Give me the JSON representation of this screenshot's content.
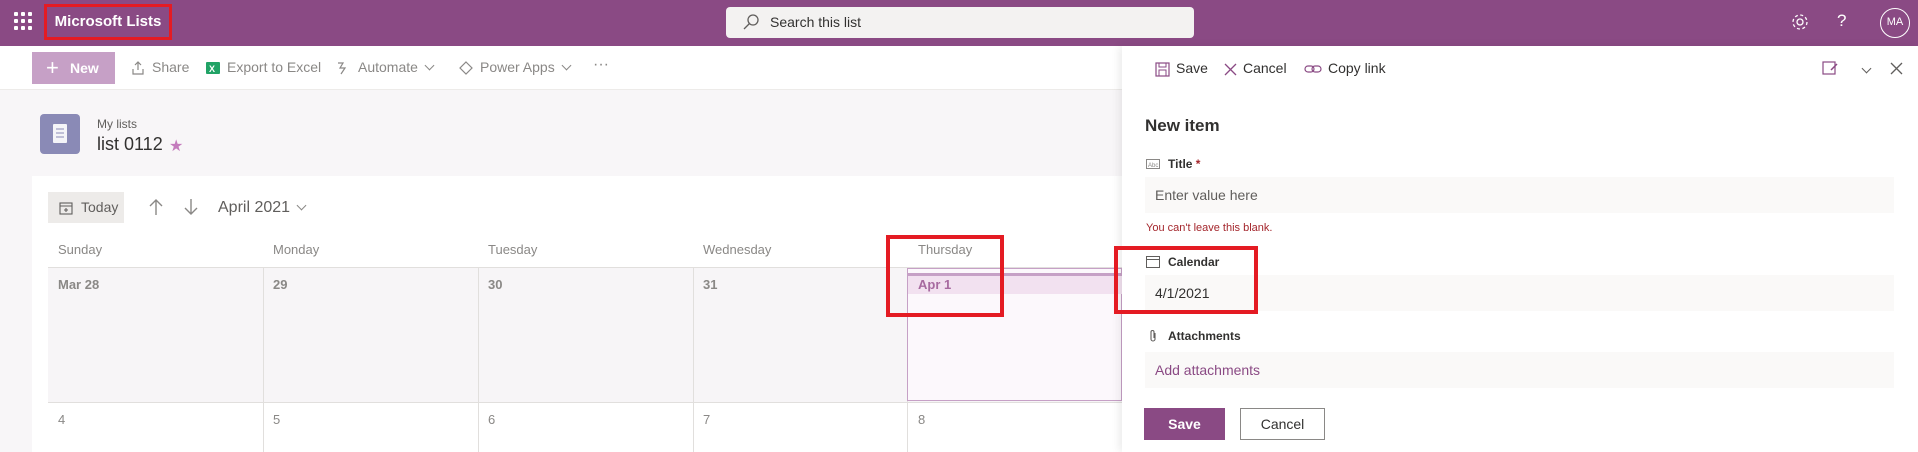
{
  "app": {
    "title": "Microsoft Lists",
    "user_initials": "MA"
  },
  "search": {
    "placeholder": "Search this list"
  },
  "toolbar": {
    "new_label": "New",
    "share_label": "Share",
    "export_label": "Export to Excel",
    "automate_label": "Automate",
    "powerapps_label": "Power Apps",
    "more_label": "···"
  },
  "list": {
    "breadcrumb": "My lists",
    "name": "list 0112"
  },
  "calendar": {
    "today_label": "Today",
    "month_label": "April 2021",
    "weekdays": [
      "Sunday",
      "Monday",
      "Tuesday",
      "Wednesday",
      "Thursday"
    ],
    "week1_days": [
      "Mar 28",
      "29",
      "30",
      "31",
      "Apr 1"
    ],
    "week2_days": [
      "4",
      "5",
      "6",
      "7",
      "8"
    ]
  },
  "panel": {
    "save_cmd": "Save",
    "cancel_cmd": "Cancel",
    "copylink_cmd": "Copy link",
    "title": "New item",
    "fields": {
      "title_label": "Title",
      "title_required": "*",
      "title_placeholder": "Enter value here",
      "title_error": "You can't leave this blank.",
      "calendar_label": "Calendar",
      "calendar_value": "4/1/2021",
      "attachments_label": "Attachments",
      "attachments_link": "Add attachments"
    },
    "save_button": "Save",
    "cancel_button": "Cancel"
  },
  "colors": {
    "brand": "#8a4a84",
    "highlight": "#e41b23"
  }
}
